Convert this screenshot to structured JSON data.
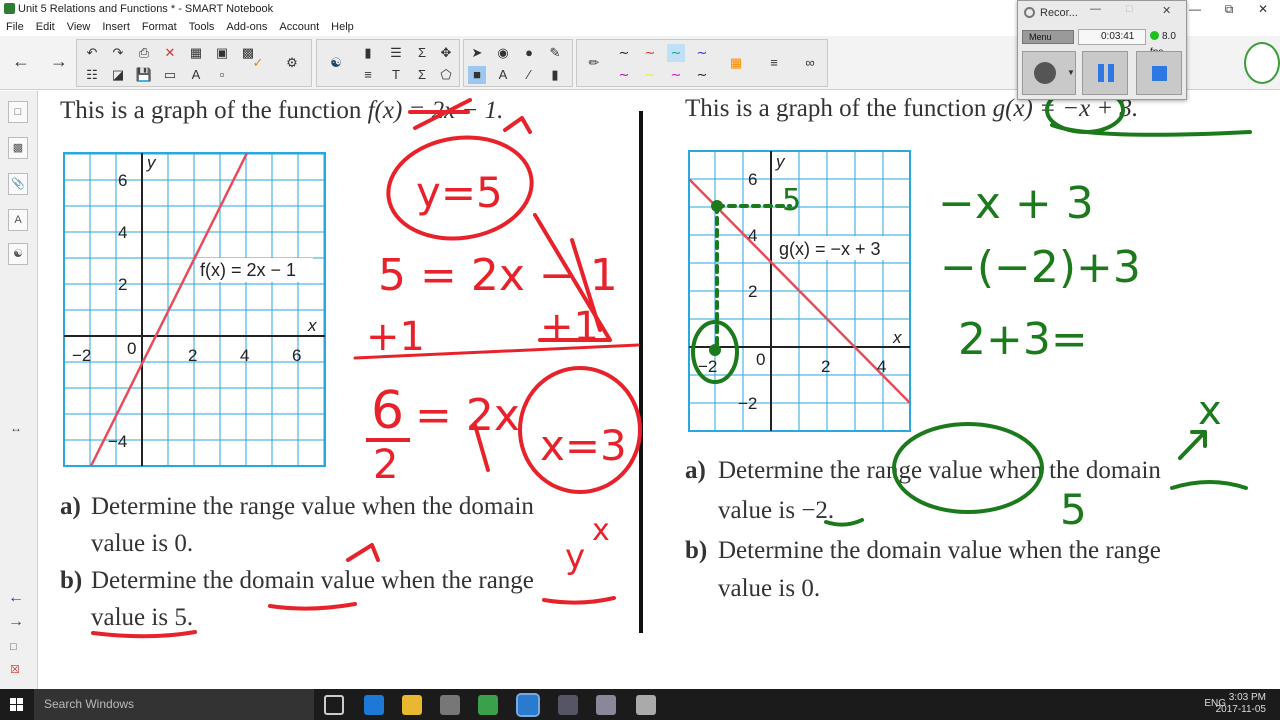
{
  "window": {
    "title": "Unit 5 Relations and Functions * - SMART Notebook"
  },
  "menu": [
    "File",
    "Edit",
    "View",
    "Insert",
    "Format",
    "Tools",
    "Add-ons",
    "Account",
    "Help"
  ],
  "recorder": {
    "title": "Recor...",
    "menu_label": "Menu",
    "time": "0:03:41",
    "fps": "8.0 fps"
  },
  "left_problem": {
    "heading_prefix": "This is a graph of the function ",
    "heading_func": "f(x) = 2x − 1.",
    "graph_label": "f(x) = 2x − 1",
    "y_ticks": [
      "6",
      "4",
      "2",
      "−4"
    ],
    "x_ticks": [
      "−2",
      "0",
      "2",
      "4",
      "6"
    ],
    "axis_x": "x",
    "axis_y": "y",
    "a_letter": "a)",
    "a_line1": "Determine the range value when the domain",
    "a_line2": "value is 0.",
    "b_letter": "b)",
    "b_line1": "Determine the domain value when the range",
    "b_line2": "value is 5."
  },
  "right_problem": {
    "heading_prefix": "This is a graph of the function ",
    "heading_func": "g(x) = −x + 3.",
    "graph_label": "g(x) = −x + 3",
    "y_ticks": [
      "6",
      "4",
      "2",
      "−2"
    ],
    "x_ticks": [
      "−2",
      "0",
      "2",
      "4"
    ],
    "axis_x": "x",
    "axis_y": "y",
    "a_letter": "a)",
    "a_line1": "Determine the range value when the domain",
    "a_line2": "value is −2.",
    "b_letter": "b)",
    "b_line1": "Determine the domain value when the range",
    "b_line2": "value is 0."
  },
  "handwriting": {
    "left_y_eq": "y=5",
    "left_eq1": "5 = 2x − 1",
    "left_plus": "+1",
    "left_plus2": "+1",
    "left_eq2_lhs": "6",
    "left_eq2_eq": "= 2x",
    "left_eq2_den": "2",
    "left_answer": "x=3",
    "right_y5": "5",
    "right_line1": "−x + 3",
    "right_line2": "−(−2)+3",
    "right_line3": "2+3=",
    "right_answer": "5",
    "right_x": "x",
    "arrow_x": "x",
    "arrow_y": "y"
  },
  "taskbar": {
    "search_placeholder": "Search Windows",
    "lang": "ENG",
    "time": "3:03 PM",
    "date": "2017-11-05"
  },
  "colors": {
    "red_ink": "#e8222b",
    "green_ink": "#1c7a1c",
    "grid": "#29a7e1",
    "line": "#e74c5a"
  }
}
